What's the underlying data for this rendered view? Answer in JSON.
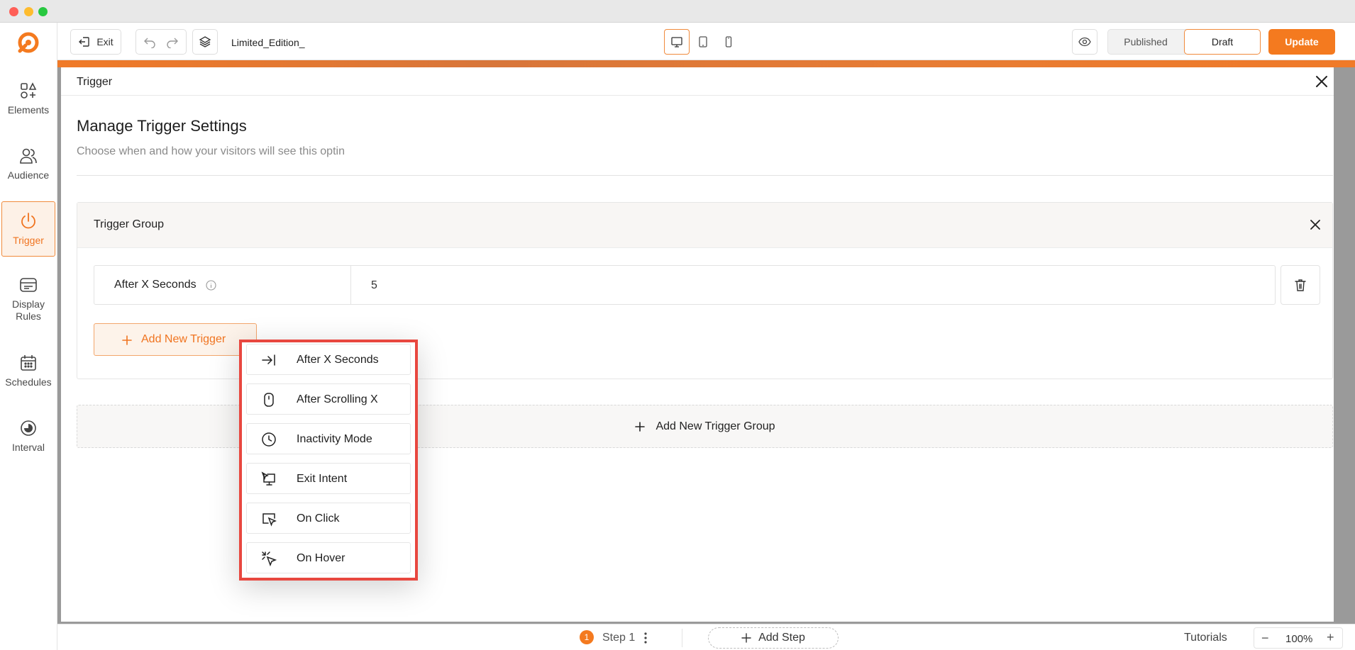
{
  "topbar": {
    "exit_label": "Exit",
    "doc_title": "Limited_Edition_",
    "status_published": "Published",
    "status_draft": "Draft",
    "update_label": "Update"
  },
  "sidebar": {
    "items": [
      {
        "label": "Elements",
        "icon": "elements-icon"
      },
      {
        "label": "Audience",
        "icon": "audience-icon"
      },
      {
        "label": "Trigger",
        "icon": "power-icon",
        "active": true
      },
      {
        "label": "Display Rules",
        "icon": "display-rules-icon"
      },
      {
        "label": "Schedules",
        "icon": "calendar-icon"
      },
      {
        "label": "Interval",
        "icon": "interval-icon"
      }
    ]
  },
  "panel": {
    "title": "Trigger",
    "heading": "Manage Trigger Settings",
    "subheading": "Choose when and how your visitors will see this optin",
    "group": {
      "title": "Trigger Group",
      "trigger_label": "After X Seconds",
      "trigger_value": "5",
      "add_trigger_label": "Add New Trigger"
    },
    "add_group_label": "Add New Trigger Group"
  },
  "dropdown": {
    "items": [
      {
        "label": "After X Seconds",
        "icon": "arrow-to-line-icon"
      },
      {
        "label": "After Scrolling X",
        "icon": "mouse-icon"
      },
      {
        "label": "Inactivity Mode",
        "icon": "clock-icon"
      },
      {
        "label": "Exit Intent",
        "icon": "monitor-cursor-icon"
      },
      {
        "label": "On Click",
        "icon": "click-cursor-icon"
      },
      {
        "label": "On Hover",
        "icon": "hover-cursor-icon"
      }
    ]
  },
  "bottombar": {
    "step_number": "1",
    "step_label": "Step 1",
    "add_step_label": "Add Step",
    "tutorials_label": "Tutorials",
    "zoom_value": "100%"
  },
  "colors": {
    "accent": "#f47a1f",
    "highlight_border": "#e8473f"
  }
}
